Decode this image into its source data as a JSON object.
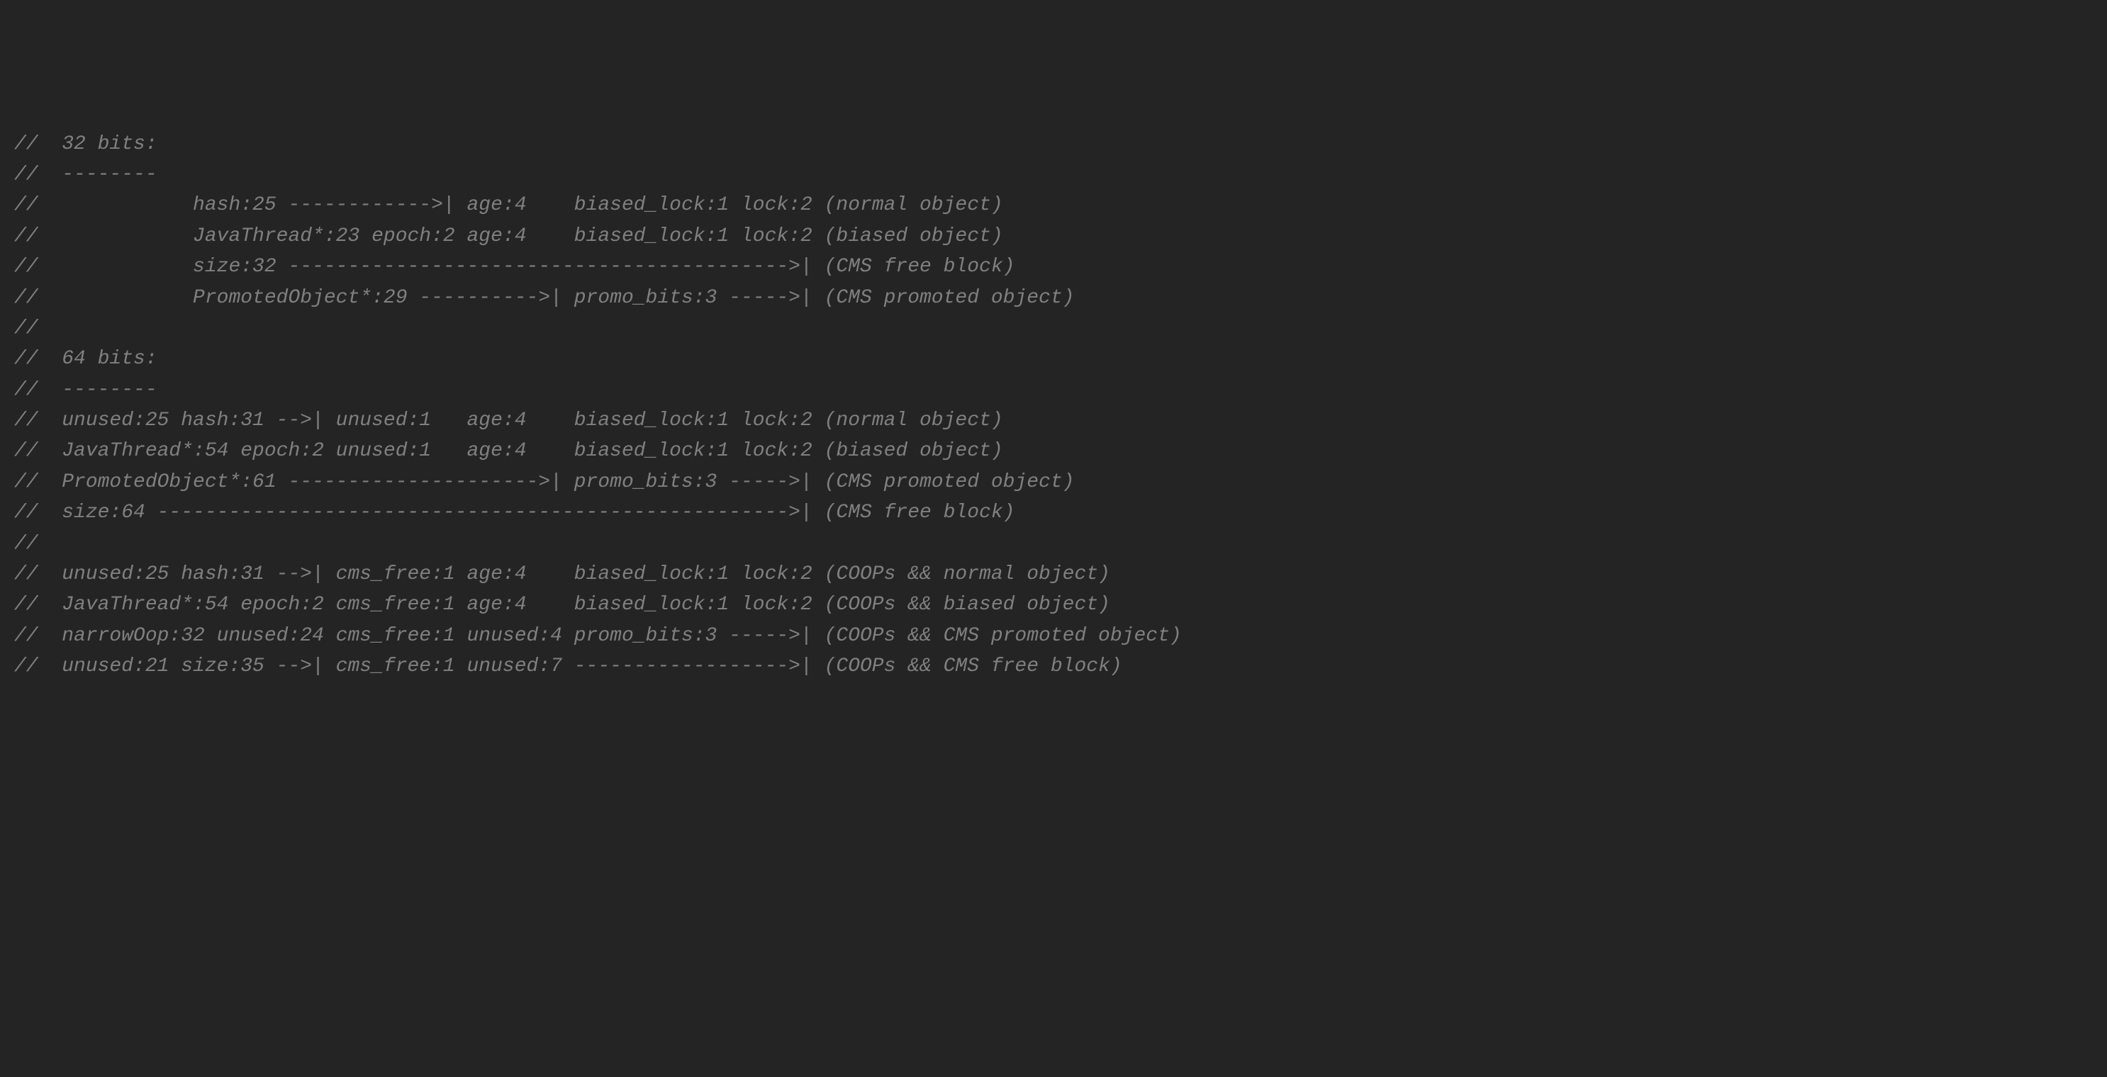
{
  "colors": {
    "background": "#242424",
    "comment": "#808080"
  },
  "font": {
    "family": "monospace",
    "style": "italic"
  },
  "lines": [
    "//  32 bits:",
    "//  --------",
    "//             hash:25 ------------>| age:4    biased_lock:1 lock:2 (normal object)",
    "//             JavaThread*:23 epoch:2 age:4    biased_lock:1 lock:2 (biased object)",
    "//             size:32 ------------------------------------------>| (CMS free block)",
    "//             PromotedObject*:29 ---------->| promo_bits:3 ----->| (CMS promoted object)",
    "//",
    "//  64 bits:",
    "//  --------",
    "//  unused:25 hash:31 -->| unused:1   age:4    biased_lock:1 lock:2 (normal object)",
    "//  JavaThread*:54 epoch:2 unused:1   age:4    biased_lock:1 lock:2 (biased object)",
    "//  PromotedObject*:61 --------------------->| promo_bits:3 ----->| (CMS promoted object)",
    "//  size:64 ----------------------------------------------------->| (CMS free block)",
    "//",
    "//  unused:25 hash:31 -->| cms_free:1 age:4    biased_lock:1 lock:2 (COOPs && normal object)",
    "//  JavaThread*:54 epoch:2 cms_free:1 age:4    biased_lock:1 lock:2 (COOPs && biased object)",
    "//  narrowOop:32 unused:24 cms_free:1 unused:4 promo_bits:3 ----->| (COOPs && CMS promoted object)",
    "//  unused:21 size:35 -->| cms_free:1 unused:7 ------------------>| (COOPs && CMS free block)"
  ]
}
